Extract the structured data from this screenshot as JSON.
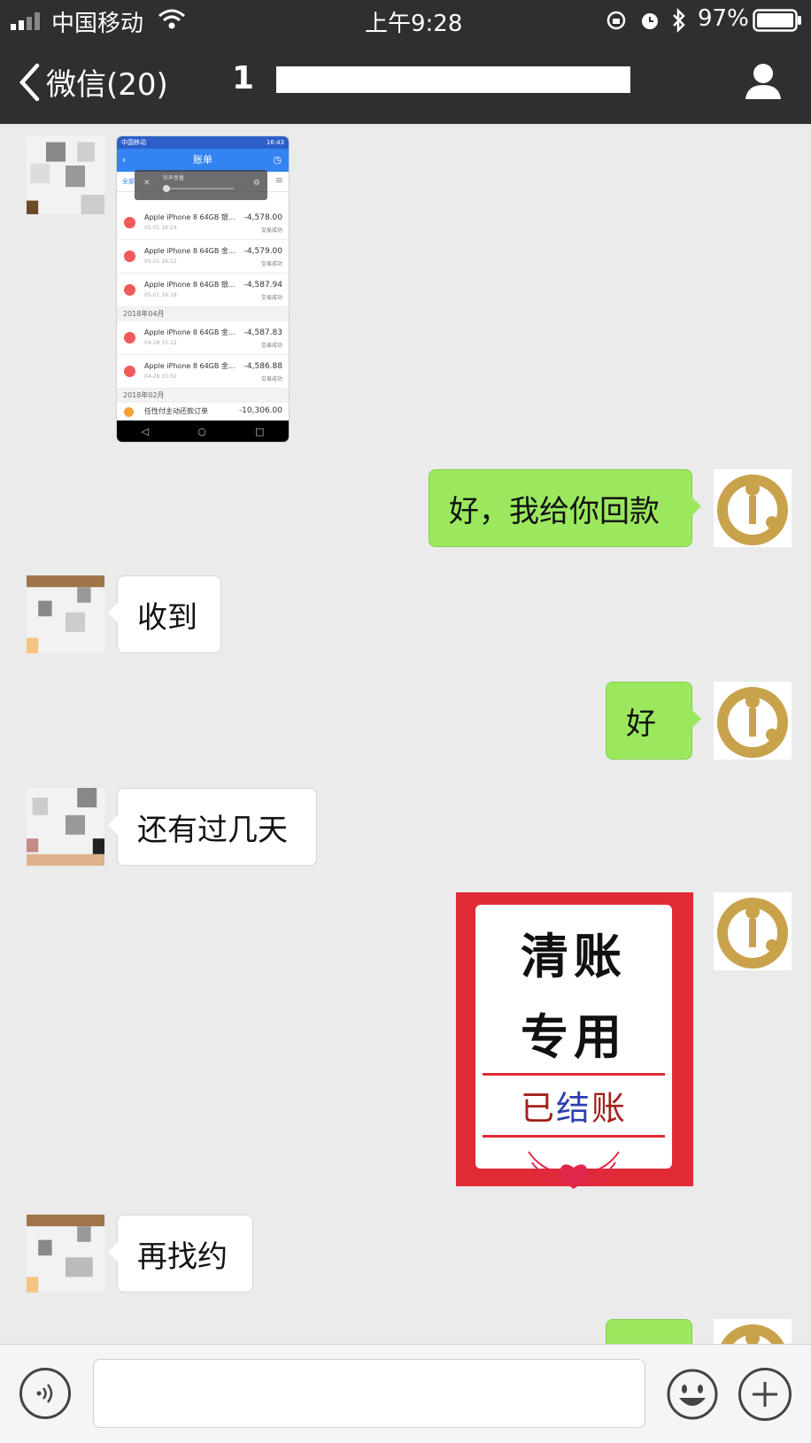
{
  "status_bar": {
    "carrier": "中国移动",
    "time": "上午9:28",
    "battery": "97%"
  },
  "nav": {
    "back_label": "微信(20)",
    "title_visible": "1"
  },
  "messages": [
    {
      "side": "left",
      "kind": "image",
      "screenshot": {
        "status_left": "中国移动",
        "status_right": "16:43",
        "header": "账单",
        "tab_first": "全部",
        "overlay_label": "铃声音量",
        "months": [
          "2018年04月",
          "2018年02月"
        ],
        "rows": [
          {
            "name": "Apple iPhone 8 64GB 银...",
            "date": "05-01 16:24",
            "amount": "-4,578.00",
            "status": "交易成功"
          },
          {
            "name": "Apple iPhone 8 64GB 金...",
            "date": "05-01 16:22",
            "amount": "-4,579.00",
            "status": "交易成功"
          },
          {
            "name": "Apple iPhone 8 64GB 银...",
            "date": "05-01 16:18",
            "amount": "-4,587.94",
            "status": "交易成功"
          },
          {
            "name": "Apple iPhone 8 64GB 金...",
            "date": "04-28 15:12",
            "amount": "-4,587.83",
            "status": "交易成功"
          },
          {
            "name": "Apple iPhone 8 64GB 金...",
            "date": "04-28 15:02",
            "amount": "-4,586.88",
            "status": "交易成功"
          },
          {
            "name": "任性付主动还款订单",
            "date": "",
            "amount": "-10,306.00",
            "status": ""
          }
        ]
      }
    },
    {
      "side": "right",
      "kind": "text",
      "text": "好，我给你回款"
    },
    {
      "side": "left",
      "kind": "text",
      "text": "收到"
    },
    {
      "side": "right",
      "kind": "text",
      "text": "好"
    },
    {
      "side": "left",
      "kind": "text",
      "text": "还有过几天"
    },
    {
      "side": "right",
      "kind": "sticker",
      "sticker": {
        "line1": "清账",
        "line2": "专用",
        "line3_a": "已",
        "line3_b": "结",
        "line3_c": "账"
      }
    },
    {
      "side": "left",
      "kind": "text",
      "text": "再找约"
    },
    {
      "side": "right",
      "kind": "text",
      "text": ""
    }
  ],
  "colors": {
    "header_bg": "#2f2f31",
    "chat_bg": "#ebebeb",
    "bubble_sent": "#9be85f",
    "bubble_received": "#ffffff",
    "avatar_gold": "#c9a24c"
  },
  "icons": [
    "signal-icon",
    "wifi-icon",
    "rotation-lock-icon",
    "alarm-icon",
    "bluetooth-icon",
    "battery-icon",
    "back-chevron-icon",
    "contact-icon",
    "voice-icon",
    "emoji-icon",
    "plus-icon"
  ]
}
